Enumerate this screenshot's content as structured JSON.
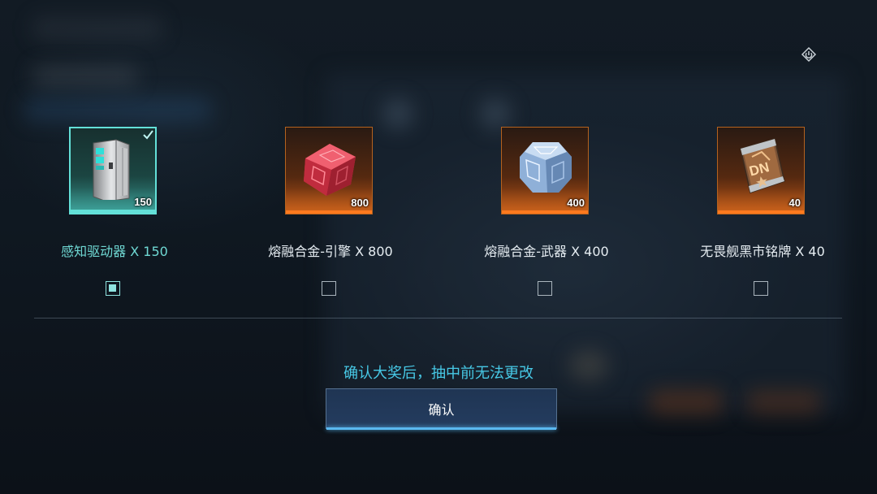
{
  "rewards": [
    {
      "name": "感知驱动器 X 150",
      "quantity": "150",
      "selected": true,
      "icon": "sensor-drive-icon"
    },
    {
      "name": "熔融合金-引擎 X 800",
      "quantity": "800",
      "selected": false,
      "icon": "red-alloy-engine-icon"
    },
    {
      "name": "熔融合金-武器 X 400",
      "quantity": "400",
      "selected": false,
      "icon": "blue-alloy-weapon-icon"
    },
    {
      "name": "无畏舰黑市铭牌 X 40",
      "quantity": "40",
      "selected": false,
      "icon": "dn-nameplate-icon"
    }
  ],
  "notice": "确认大奖后，抽中前无法更改",
  "confirm_label": "确认",
  "colors": {
    "selected_accent": "#63e0d8",
    "unselected_frame": "#b5621e",
    "notice_text": "#47c9e6",
    "button_fill": "#1f3553"
  }
}
